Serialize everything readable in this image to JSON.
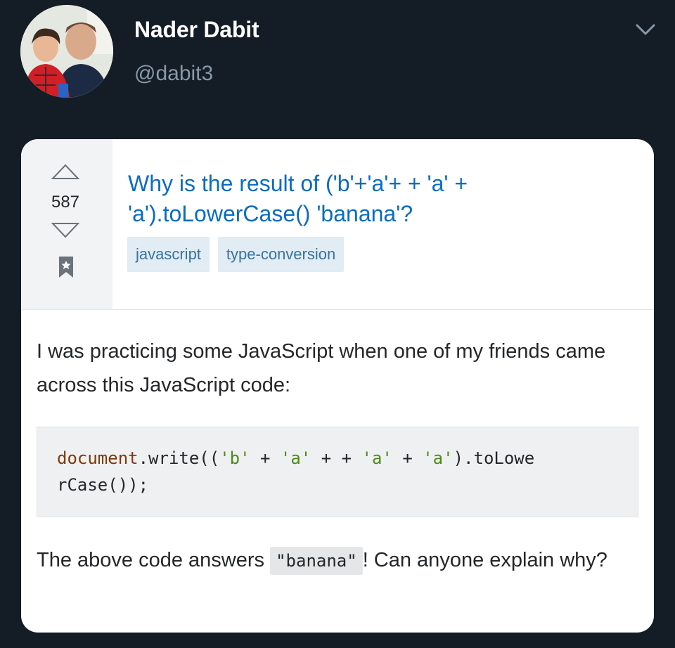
{
  "tweet": {
    "author_name": "Nader Dabit",
    "author_handle": "@dabit3"
  },
  "question": {
    "vote_count": "587",
    "title": "Why is the result of ('b'+'a'+ + 'a' + 'a').toLowerCase() 'banana'?",
    "tags": [
      "javascript",
      "type-conversion"
    ],
    "body_intro": "I was practicing some JavaScript when one of my friends came across this JavaScript code:",
    "code_line1": [
      "document",
      ".write((",
      "'b'",
      " + ",
      "'a'",
      " + + ",
      "'a'",
      " + ",
      "'a'",
      ").toLowe"
    ],
    "code_line2": "rCase());",
    "body_answer_pre": "The above code answers ",
    "body_answer_code": "\"banana\"",
    "body_answer_post": "! Can anyone explain why?"
  },
  "colors": {
    "background": "#141d26",
    "title_link": "#0b6cbf",
    "tag_bg": "#e1ecf4",
    "tag_text": "#39739d"
  },
  "icons": [
    "chevron-down-icon",
    "upvote-arrow-icon",
    "downvote-arrow-icon",
    "bookmark-star-icon"
  ]
}
